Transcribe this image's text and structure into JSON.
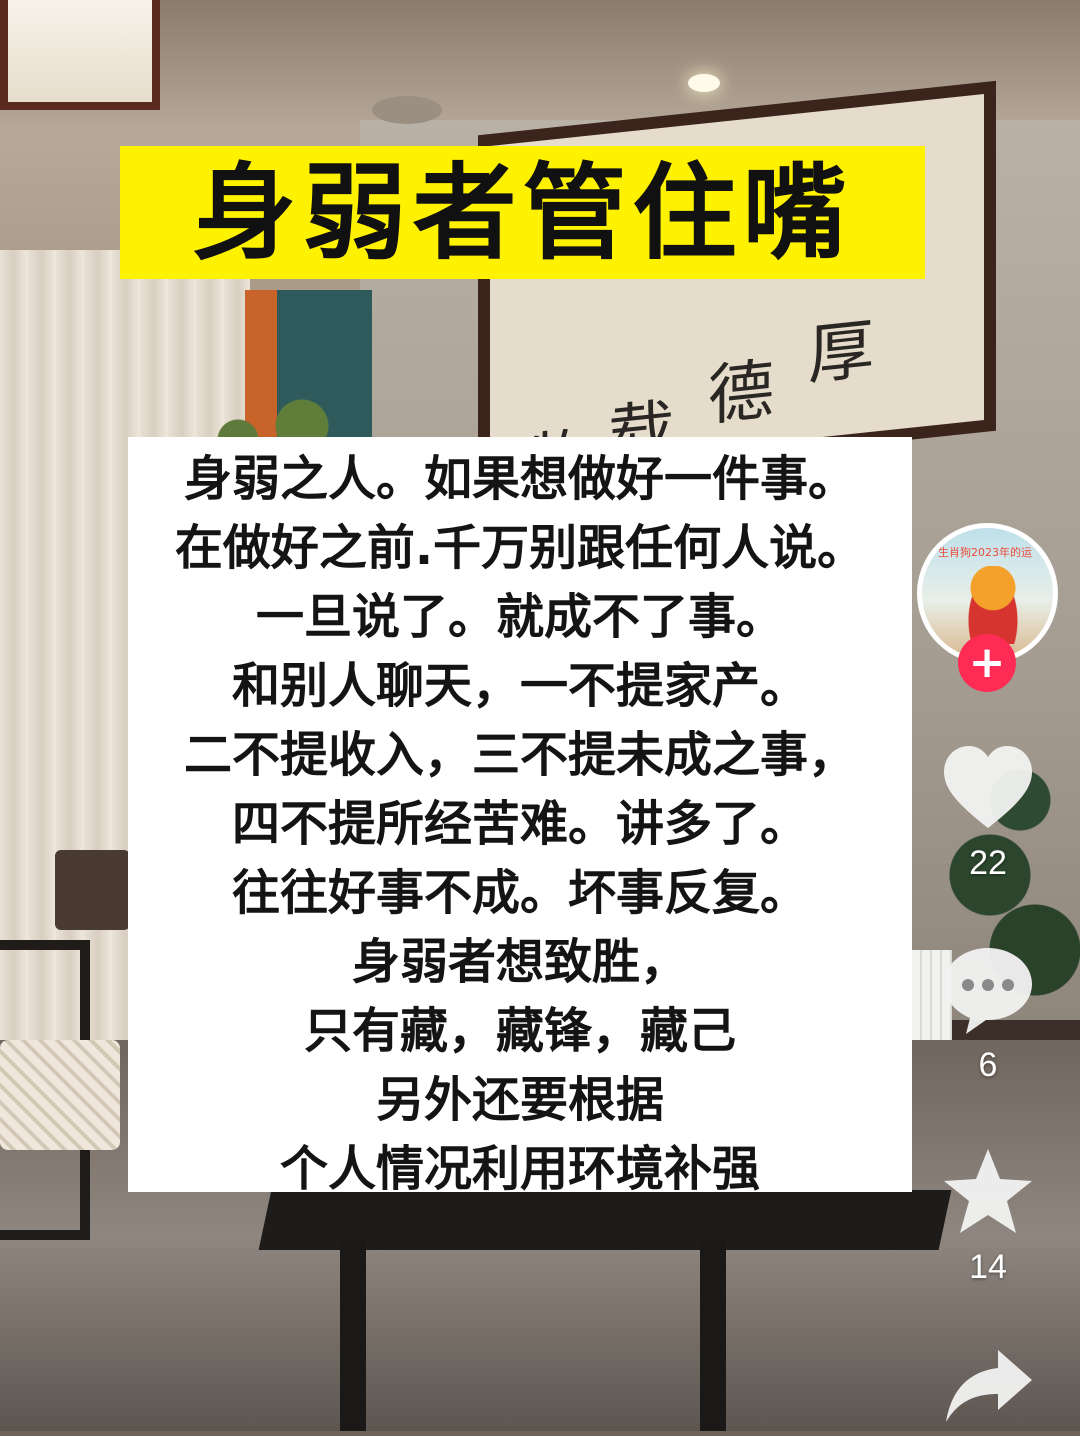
{
  "title": "身弱者管住嘴",
  "body_lines": [
    "身弱之人。如果想做好一件事。",
    "在做好之前.千万别跟任何人说。",
    "一旦说了。就成不了事。",
    "和别人聊天，一不提家产。",
    "二不提收入，三不提未成之事，",
    "四不提所经苦难。讲多了。",
    "往往好事不成。坏事反复。",
    "身弱者想致胜，",
    "只有藏，藏锋，藏己",
    "另外还要根据",
    "个人情况利用环境补强"
  ],
  "background_calligraphy": [
    "厚",
    "德",
    "载",
    "物"
  ],
  "avatar": {
    "caption": "生肖狗2023年的运",
    "follow_label": "+"
  },
  "actions": {
    "like": {
      "icon": "heart-icon",
      "count": "22"
    },
    "comment": {
      "icon": "comment-icon",
      "count": "6"
    },
    "favorite": {
      "icon": "star-icon",
      "count": "14"
    },
    "share": {
      "icon": "share-icon"
    }
  },
  "colors": {
    "banner": "#fff200",
    "follow": "#fe2c55"
  }
}
